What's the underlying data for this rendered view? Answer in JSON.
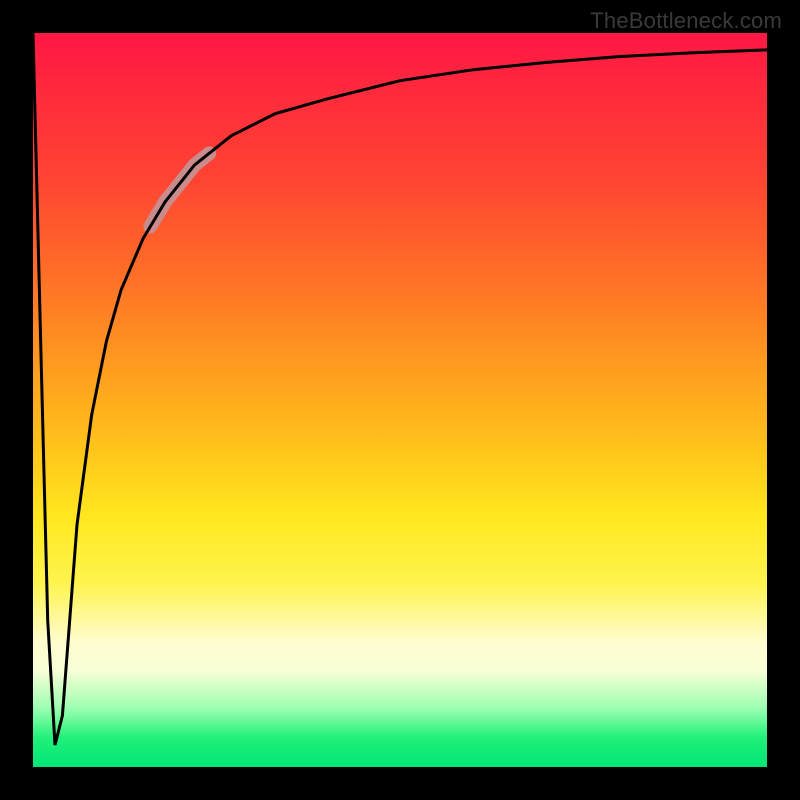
{
  "attribution": "TheBottleneck.com",
  "chart_data": {
    "type": "line",
    "title": "",
    "xlabel": "",
    "ylabel": "",
    "xlim": [
      0,
      100
    ],
    "ylim": [
      0,
      100
    ],
    "grid": false,
    "legend": false,
    "background_gradient": {
      "orientation": "vertical",
      "stops": [
        {
          "pos": 0.0,
          "color": "#ff1744"
        },
        {
          "pos": 0.33,
          "color": "#ff6f27"
        },
        {
          "pos": 0.66,
          "color": "#ffe81f"
        },
        {
          "pos": 0.85,
          "color": "#fffccf"
        },
        {
          "pos": 1.0,
          "color": "#00e676"
        }
      ]
    },
    "series": [
      {
        "name": "curve",
        "color": "#000000",
        "x": [
          0,
          1,
          2,
          3,
          4,
          5,
          6,
          8,
          10,
          12,
          15,
          18,
          22,
          27,
          33,
          40,
          50,
          60,
          70,
          80,
          90,
          100
        ],
        "y": [
          100,
          60,
          20,
          3,
          7,
          20,
          33,
          48,
          58,
          65,
          72,
          77,
          82,
          86,
          89,
          91,
          93.5,
          95,
          96,
          96.8,
          97.3,
          97.7
        ]
      }
    ],
    "highlight_segment": {
      "series": "curve",
      "x_range": [
        16,
        24
      ],
      "color": "#c98b8b",
      "width": 14
    }
  }
}
